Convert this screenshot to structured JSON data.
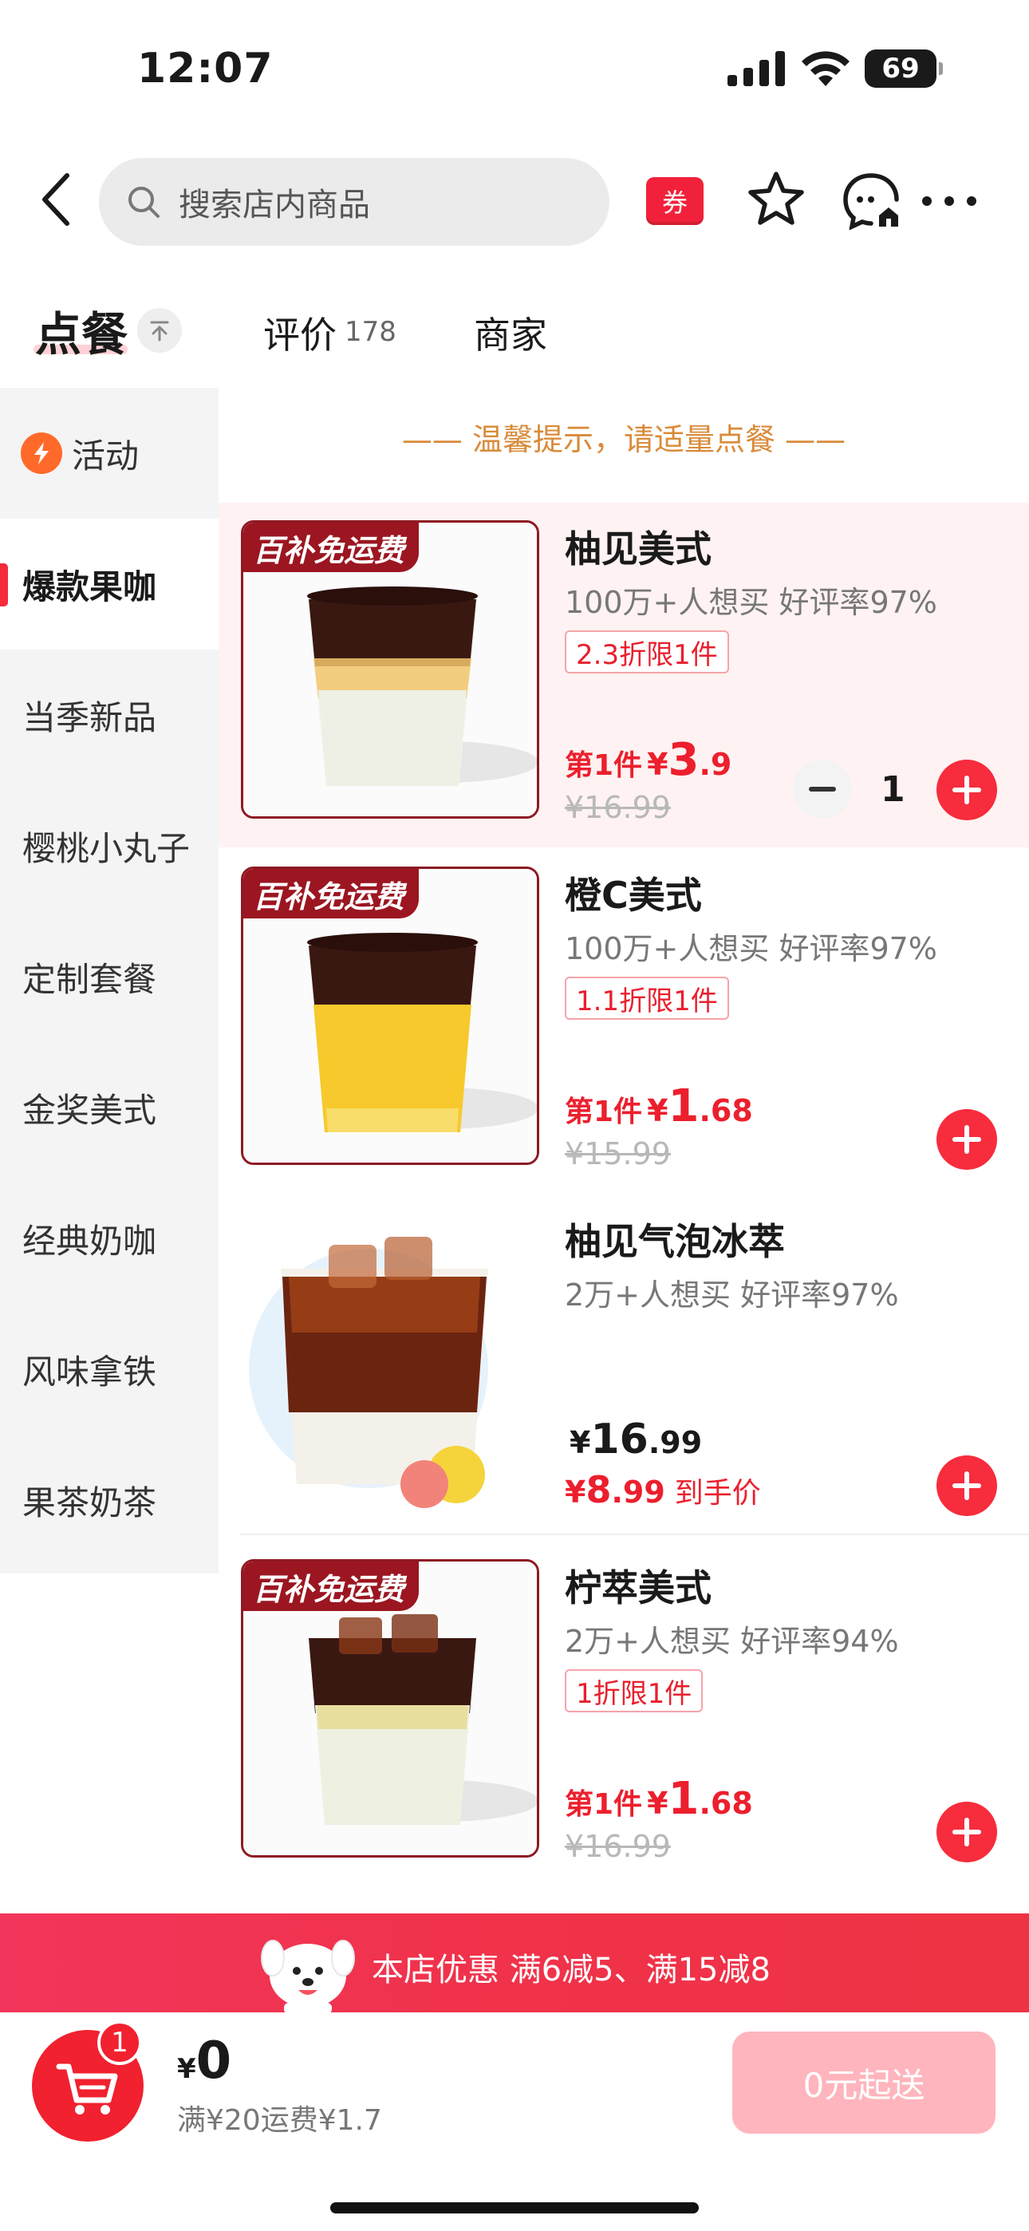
{
  "status_bar": {
    "time": "12:07",
    "battery": "69"
  },
  "header": {
    "search_placeholder": "搜索店内商品",
    "coupon_label": "券"
  },
  "tabs": {
    "order": "点餐",
    "review": "评价",
    "review_count": "178",
    "merchant": "商家"
  },
  "sidebar": {
    "items": [
      {
        "label": "活动"
      },
      {
        "label": "爆款果咖"
      },
      {
        "label": "当季新品"
      },
      {
        "label": "樱桃小丸子"
      },
      {
        "label": "定制套餐"
      },
      {
        "label": "金奖美式"
      },
      {
        "label": "经典奶咖"
      },
      {
        "label": "风味拿铁"
      },
      {
        "label": "果茶奶茶"
      }
    ]
  },
  "tip": "—— 温馨提示，请适量点餐 ——",
  "products": [
    {
      "tag": "百补免运费",
      "name": "柚见美式",
      "sub": "100万+人想买  好评率97%",
      "discount": "2.3折限1件",
      "price_prefix": "第1件",
      "currency": "¥",
      "price_int": "3",
      "price_dec": ".9",
      "orig_price": "¥16.99",
      "quantity": "1"
    },
    {
      "tag": "百补免运费",
      "name": "橙C美式",
      "sub": "100万+人想买  好评率97%",
      "discount": "1.1折限1件",
      "price_prefix": "第1件",
      "currency": "¥",
      "price_int": "1",
      "price_dec": ".68",
      "orig_price": "¥15.99"
    },
    {
      "name": "柚见气泡冰萃",
      "sub": "2万+人想买  好评率97%",
      "currency": "¥",
      "price_int": "16",
      "price_dec": ".99",
      "final_int": "8",
      "final_dec": ".99",
      "final_label": "到手价"
    },
    {
      "tag": "百补免运费",
      "name": "柠萃美式",
      "sub": "2万+人想买  好评率94%",
      "discount": "1折限1件",
      "price_prefix": "第1件",
      "currency": "¥",
      "price_int": "1",
      "price_dec": ".68",
      "orig_price": "¥16.99"
    }
  ],
  "promo": {
    "text": "本店优惠   满6减5、满15减8"
  },
  "cart": {
    "badge": "1",
    "currency": "¥",
    "total": "0",
    "fee": "满¥20运费¥1.7",
    "checkout": "0元起送"
  },
  "colors": {
    "accent": "#f52a3b",
    "tag": "#9b1621",
    "tip": "#d98b3a",
    "checkout_disabled": "#ffb5bd"
  }
}
